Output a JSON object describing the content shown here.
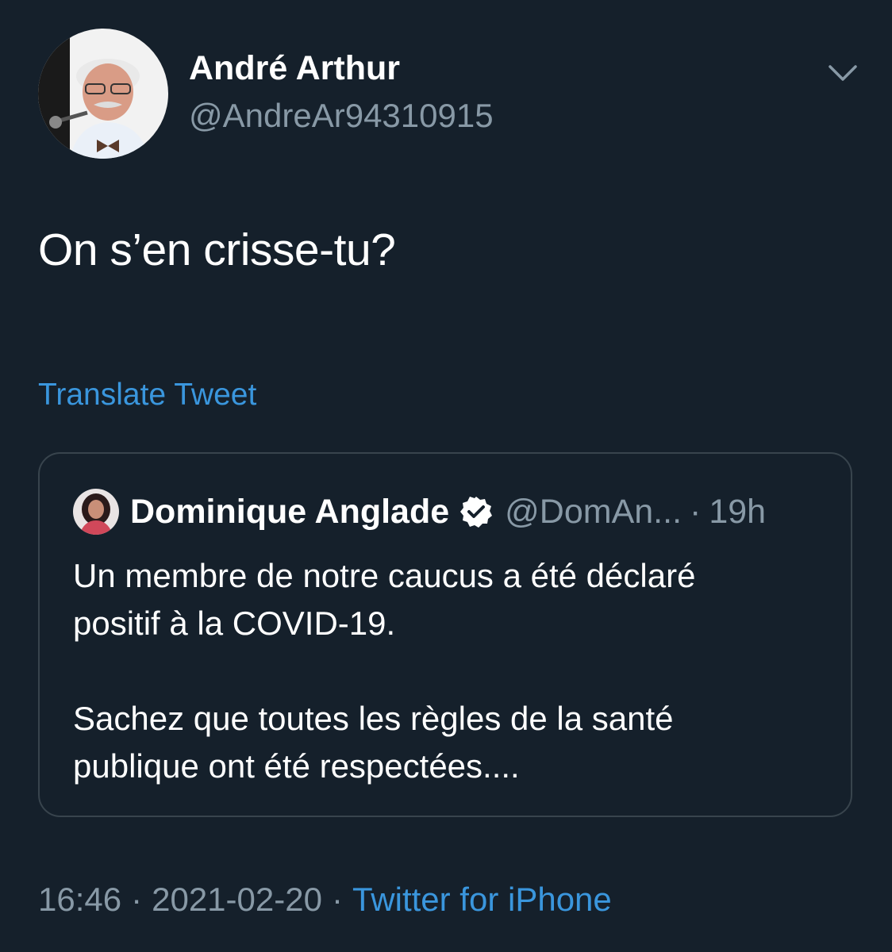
{
  "tweet": {
    "author": {
      "display_name": "André Arthur",
      "handle": "@AndreAr94310915"
    },
    "text": "On s’en crisse-tu?",
    "translate_label": "Translate Tweet",
    "menu_icon": "chevron-down-icon",
    "quoted": {
      "display_name": "Dominique Anglade",
      "handle": "@DomAn...",
      "separator": "·",
      "time": "19h",
      "verified_icon": "verified-badge-icon",
      "body_lines": [
        "Un membre de notre caucus a été déclaré",
        "positif à la COVID-19.",
        "",
        "Sachez que toutes les règles de la santé",
        "publique ont été respectées...."
      ]
    },
    "footer": {
      "time": "16:46",
      "separator": "·",
      "date": "2021-02-20",
      "source": "Twitter for iPhone"
    }
  },
  "colors": {
    "background": "#15202b",
    "secondary_text": "#8899a6",
    "link": "#3a96dd",
    "border": "#38444d"
  }
}
